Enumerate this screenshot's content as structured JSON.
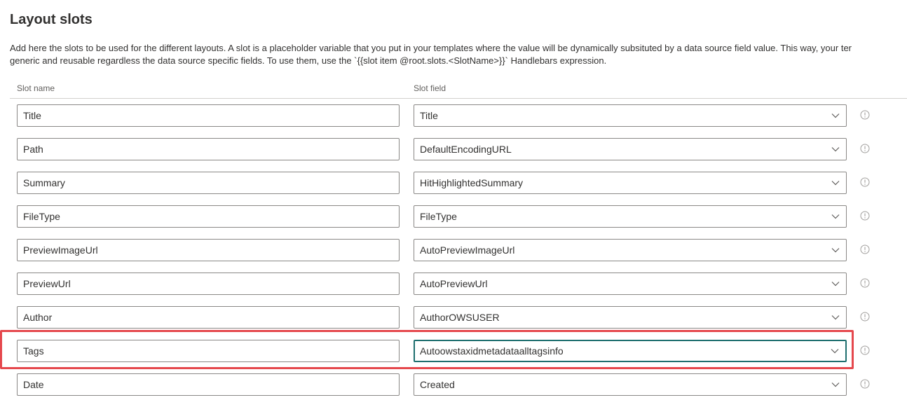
{
  "section": {
    "title": "Layout slots",
    "description_line1": "Add here the slots to be used for the different layouts. A slot is a placeholder variable that you put in your templates where the value will be dynamically subsituted by a data source field value. This way, your ter",
    "description_line2": "generic and reusable regardless the data source specific fields. To use them, use the `{{slot item @root.slots.<SlotName>}}` Handlebars expression."
  },
  "table": {
    "headers": {
      "slot_name": "Slot name",
      "slot_field": "Slot field"
    },
    "rows": [
      {
        "name": "Title",
        "field": "Title"
      },
      {
        "name": "Path",
        "field": "DefaultEncodingURL"
      },
      {
        "name": "Summary",
        "field": "HitHighlightedSummary"
      },
      {
        "name": "FileType",
        "field": "FileType"
      },
      {
        "name": "PreviewImageUrl",
        "field": "AutoPreviewImageUrl"
      },
      {
        "name": "PreviewUrl",
        "field": "AutoPreviewUrl"
      },
      {
        "name": "Author",
        "field": "AuthorOWSUSER"
      },
      {
        "name": "Tags",
        "field": "Autoowstaxidmetadataalltagsinfo"
      },
      {
        "name": "Date",
        "field": "Created"
      }
    ],
    "focused_row": 7
  },
  "icons": {
    "dropdown": "chevron-down-icon",
    "info": "info-icon"
  },
  "colors": {
    "highlight": "#e5484d",
    "focus_border": "#1e6f6f",
    "input_border": "#8a8886"
  }
}
